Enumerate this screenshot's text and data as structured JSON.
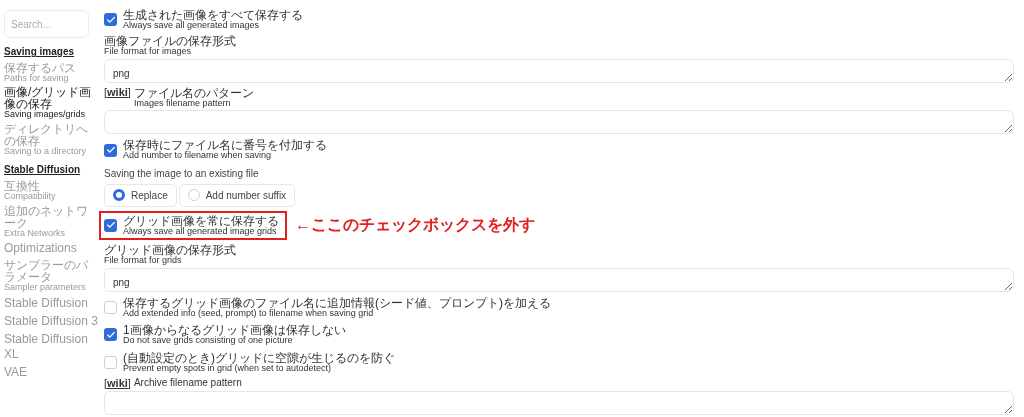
{
  "sidebar": {
    "search": {
      "placeholder": "Search..."
    },
    "sections": [
      {
        "title": "Saving images",
        "items": [
          {
            "kind": "pair",
            "ja": "保存するパス",
            "en": "Paths for saving",
            "selected": false
          },
          {
            "kind": "pair",
            "ja": "画像/グリッド画像の保存",
            "en": "Saving images/grids",
            "selected": true
          },
          {
            "kind": "pair",
            "ja": "ディレクトリへの保存",
            "en": "Saving to a directory",
            "selected": false
          }
        ]
      },
      {
        "title": "Stable Diffusion",
        "items": [
          {
            "kind": "pair",
            "ja": "互換性",
            "en": "Compatibility",
            "selected": false
          },
          {
            "kind": "pair",
            "ja": "追加のネットワーク",
            "en": "Extra Networks",
            "selected": false
          },
          {
            "kind": "large",
            "label": "Optimizations",
            "selected": false
          },
          {
            "kind": "pair",
            "ja": "サンプラーのパラメータ",
            "en": "Sampler parameters",
            "selected": false
          },
          {
            "kind": "large",
            "label": "Stable Diffusion",
            "selected": false
          },
          {
            "kind": "large",
            "label": "Stable Diffusion 3",
            "selected": false
          },
          {
            "kind": "large",
            "label": "Stable Diffusion XL",
            "selected": false
          },
          {
            "kind": "large",
            "label": "VAE",
            "selected": false
          }
        ]
      }
    ]
  },
  "settings": [
    {
      "kind": "checkbox",
      "ja": "生成された画像をすべて保存する",
      "en": "Always save all generated images",
      "checked": true,
      "highlighted": false
    },
    {
      "kind": "field",
      "ja": "画像ファイルの保存形式",
      "en": "File format for images",
      "value": "png"
    },
    {
      "kind": "field",
      "link_open": "[",
      "link": "wiki",
      "link_close": "]",
      "ja": "ファイル名のパターン",
      "en": "Images filename pattern"
    },
    {
      "kind": "checkbox",
      "ja": "保存時にファイル名に番号を付加する",
      "en": "Add number to filename when saving",
      "checked": true,
      "highlighted": false
    },
    {
      "kind": "radio",
      "label": "Saving the image to an existing file",
      "options": [
        {
          "label": "Replace",
          "selected": true
        },
        {
          "label": "Add number suffix",
          "selected": false
        }
      ]
    },
    {
      "kind": "checkbox",
      "ja": "グリッド画像を常に保存する",
      "en": "Always save all generated image grids",
      "checked": true,
      "highlighted": true,
      "annotation": "←ここのチェックボックスを外す"
    },
    {
      "kind": "field",
      "ja": "グリッド画像の保存形式",
      "en": "File format for grids",
      "value": "png"
    },
    {
      "kind": "checkbox",
      "ja": "保存するグリッド画像のファイル名に追加情報(シード値、プロンプト)を加える",
      "en": "Add extended info (seed, prompt) to filename when saving grid",
      "checked": false,
      "highlighted": false
    },
    {
      "kind": "checkbox",
      "ja": "1画像からなるグリッド画像は保存しない",
      "en": "Do not save grids consisting of one picture",
      "checked": true,
      "highlighted": false
    },
    {
      "kind": "checkbox",
      "ja": "(自動設定のとき)グリッドに空隙が生じるのを防ぐ",
      "en": "Prevent empty spots in grid (when set to autodetect)",
      "checked": false,
      "highlighted": false
    },
    {
      "kind": "field",
      "link_open": "[",
      "link": "wiki",
      "link_close": "]",
      "en": "Archive filename pattern"
    }
  ]
}
